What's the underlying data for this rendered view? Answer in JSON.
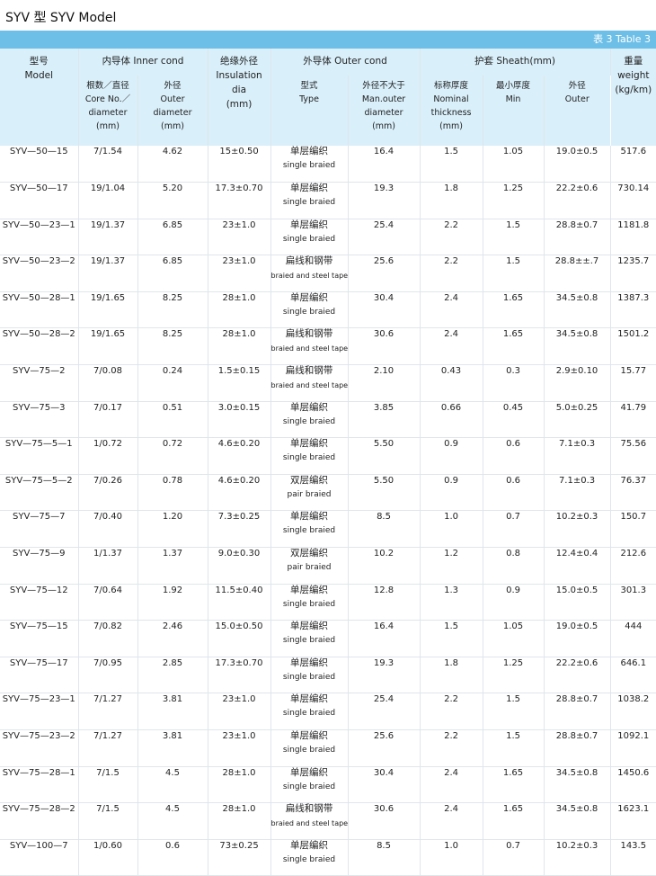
{
  "page_title": "SYV 型    SYV Model",
  "table_label": "表 3  Table 3",
  "header": {
    "model_zh": "型号",
    "model_en": "Model",
    "inner": "内导体 Inner cond",
    "insulation_zh": "绝缘外径",
    "insulation_en": "Insulation dia",
    "insulation_unit": "(mm)",
    "outer": "外导体 Outer cond",
    "sheath": "护套 Sheath(mm)",
    "weight_zh": "重量",
    "weight_en": "weight",
    "weight_unit": "(kg/km)",
    "core_zh": "根数／直径",
    "core_en1": "Core No.／",
    "core_en2": "diameter",
    "core_unit": "(mm)",
    "inner_od_zh": "外径",
    "inner_od_en1": "Outer",
    "inner_od_en2": "diameter",
    "inner_od_unit": "(mm)",
    "type_zh": "型式",
    "type_en": "Type",
    "outer_max_zh": "外径不大于",
    "outer_max_en1": "Man.outer",
    "outer_max_en2": "diameter",
    "outer_max_unit": "(mm)",
    "nominal_zh": "标称厚度",
    "nominal_en1": "Nominal",
    "nominal_en2": "thickness",
    "nominal_unit": "(mm)",
    "min_zh": "最小厚度",
    "min_en": "Min",
    "sheath_od_zh": "外径",
    "sheath_od_en": "Outer"
  },
  "rows": [
    {
      "model": "SYV—50—15",
      "core": "7/1.54",
      "inner_od": "4.62",
      "insulation": "15±0.50",
      "type_zh": "单层编织",
      "type_en": "single braied",
      "outer_max": "16.4",
      "nominal": "1.5",
      "min": "1.05",
      "sheath_od": "19.0±0.5",
      "weight": "517.6"
    },
    {
      "model": "SYV—50—17",
      "core": "19/1.04",
      "inner_od": "5.20",
      "insulation": "17.3±0.70",
      "type_zh": "单层编织",
      "type_en": "single braied",
      "outer_max": "19.3",
      "nominal": "1.8",
      "min": "1.25",
      "sheath_od": "22.2±0.6",
      "weight": "730.14"
    },
    {
      "model": "SYV—50—23—1",
      "core": "19/1.37",
      "inner_od": "6.85",
      "insulation": "23±1.0",
      "type_zh": "单层编织",
      "type_en": "single braied",
      "outer_max": "25.4",
      "nominal": "2.2",
      "min": "1.5",
      "sheath_od": "28.8±0.7",
      "weight": "1181.8"
    },
    {
      "model": "SYV—50—23—2",
      "core": "19/1.37",
      "inner_od": "6.85",
      "insulation": "23±1.0",
      "type_zh": "扁线和钢带",
      "type_en": "braied and steel tape",
      "outer_max": "25.6",
      "nominal": "2.2",
      "min": "1.5",
      "sheath_od": "28.8±±.7",
      "weight": "1235.7"
    },
    {
      "model": "SYV—50—28—1",
      "core": "19/1.65",
      "inner_od": "8.25",
      "insulation": "28±1.0",
      "type_zh": "单层编织",
      "type_en": "single braied",
      "outer_max": "30.4",
      "nominal": "2.4",
      "min": "1.65",
      "sheath_od": "34.5±0.8",
      "weight": "1387.3"
    },
    {
      "model": "SYV—50—28—2",
      "core": "19/1.65",
      "inner_od": "8.25",
      "insulation": "28±1.0",
      "type_zh": "扁线和钢带",
      "type_en": "braied and steel tape",
      "outer_max": "30.6",
      "nominal": "2.4",
      "min": "1.65",
      "sheath_od": "34.5±0.8",
      "weight": "1501.2"
    },
    {
      "model": "SYV—75—2",
      "core": "7/0.08",
      "inner_od": "0.24",
      "insulation": "1.5±0.15",
      "type_zh": "扁线和钢带",
      "type_en": "braied and steel tape",
      "outer_max": "2.10",
      "nominal": "0.43",
      "min": "0.3",
      "sheath_od": "2.9±0.10",
      "weight": "15.77"
    },
    {
      "model": "SYV—75—3",
      "core": "7/0.17",
      "inner_od": "0.51",
      "insulation": "3.0±0.15",
      "type_zh": "单层编织",
      "type_en": "single braied",
      "outer_max": "3.85",
      "nominal": "0.66",
      "min": "0.45",
      "sheath_od": "5.0±0.25",
      "weight": "41.79"
    },
    {
      "model": "SYV—75—5—1",
      "core": "1/0.72",
      "inner_od": "0.72",
      "insulation": "4.6±0.20",
      "type_zh": "单层编织",
      "type_en": "single braied",
      "outer_max": "5.50",
      "nominal": "0.9",
      "min": "0.6",
      "sheath_od": "7.1±0.3",
      "weight": "75.56"
    },
    {
      "model": "SYV—75—5—2",
      "core": "7/0.26",
      "inner_od": "0.78",
      "insulation": "4.6±0.20",
      "type_zh": "双层编织",
      "type_en": "pair braied",
      "outer_max": "5.50",
      "nominal": "0.9",
      "min": "0.6",
      "sheath_od": "7.1±0.3",
      "weight": "76.37"
    },
    {
      "model": "SYV—75—7",
      "core": "7/0.40",
      "inner_od": "1.20",
      "insulation": "7.3±0.25",
      "type_zh": "单层编织",
      "type_en": "single braied",
      "outer_max": "8.5",
      "nominal": "1.0",
      "min": "0.7",
      "sheath_od": "10.2±0.3",
      "weight": "150.7"
    },
    {
      "model": "SYV—75—9",
      "core": "1/1.37",
      "inner_od": "1.37",
      "insulation": "9.0±0.30",
      "type_zh": "双层编织",
      "type_en": "pair braied",
      "outer_max": "10.2",
      "nominal": "1.2",
      "min": "0.8",
      "sheath_od": "12.4±0.4",
      "weight": "212.6"
    },
    {
      "model": "SYV—75—12",
      "core": "7/0.64",
      "inner_od": "1.92",
      "insulation": "11.5±0.40",
      "type_zh": "单层编织",
      "type_en": "single braied",
      "outer_max": "12.8",
      "nominal": "1.3",
      "min": "0.9",
      "sheath_od": "15.0±0.5",
      "weight": "301.3"
    },
    {
      "model": "SYV—75—15",
      "core": "7/0.82",
      "inner_od": "2.46",
      "insulation": "15.0±0.50",
      "type_zh": "单层编织",
      "type_en": "single braied",
      "outer_max": "16.4",
      "nominal": "1.5",
      "min": "1.05",
      "sheath_od": "19.0±0.5",
      "weight": "444"
    },
    {
      "model": "SYV—75—17",
      "core": "7/0.95",
      "inner_od": "2.85",
      "insulation": "17.3±0.70",
      "type_zh": "单层编织",
      "type_en": "single braied",
      "outer_max": "19.3",
      "nominal": "1.8",
      "min": "1.25",
      "sheath_od": "22.2±0.6",
      "weight": "646.1"
    },
    {
      "model": "SYV—75—23—1",
      "core": "7/1.27",
      "inner_od": "3.81",
      "insulation": "23±1.0",
      "type_zh": "单层编织",
      "type_en": "single  braied",
      "outer_max": "25.4",
      "nominal": "2.2",
      "min": "1.5",
      "sheath_od": "28.8±0.7",
      "weight": "1038.2"
    },
    {
      "model": "SYV—75—23—2",
      "core": "7/1.27",
      "inner_od": "3.81",
      "insulation": "23±1.0",
      "type_zh": "单层编织",
      "type_en": "single braied",
      "outer_max": "25.6",
      "nominal": "2.2",
      "min": "1.5",
      "sheath_od": "28.8±0.7",
      "weight": "1092.1"
    },
    {
      "model": "SYV—75—28—1",
      "core": "7/1.5",
      "inner_od": "4.5",
      "insulation": "28±1.0",
      "type_zh": "单层编织",
      "type_en": "single  braied",
      "outer_max": "30.4",
      "nominal": "2.4",
      "min": "1.65",
      "sheath_od": "34.5±0.8",
      "weight": "1450.6"
    },
    {
      "model": "SYV—75—28—2",
      "core": "7/1.5",
      "inner_od": "4.5",
      "insulation": "28±1.0",
      "type_zh": "扁线和钢带",
      "type_en": "braied and steel tape",
      "outer_max": "30.6",
      "nominal": "2.4",
      "min": "1.65",
      "sheath_od": "34.5±0.8",
      "weight": "1623.1"
    },
    {
      "model": "SYV—100—7",
      "core": "1/0.60",
      "inner_od": "0.6",
      "insulation": "73±0.25",
      "type_zh": "单层编织",
      "type_en": "single braied",
      "outer_max": "8.5",
      "nominal": "1.0",
      "min": "0.7",
      "sheath_od": "10.2±0.3",
      "weight": "143.5"
    }
  ]
}
